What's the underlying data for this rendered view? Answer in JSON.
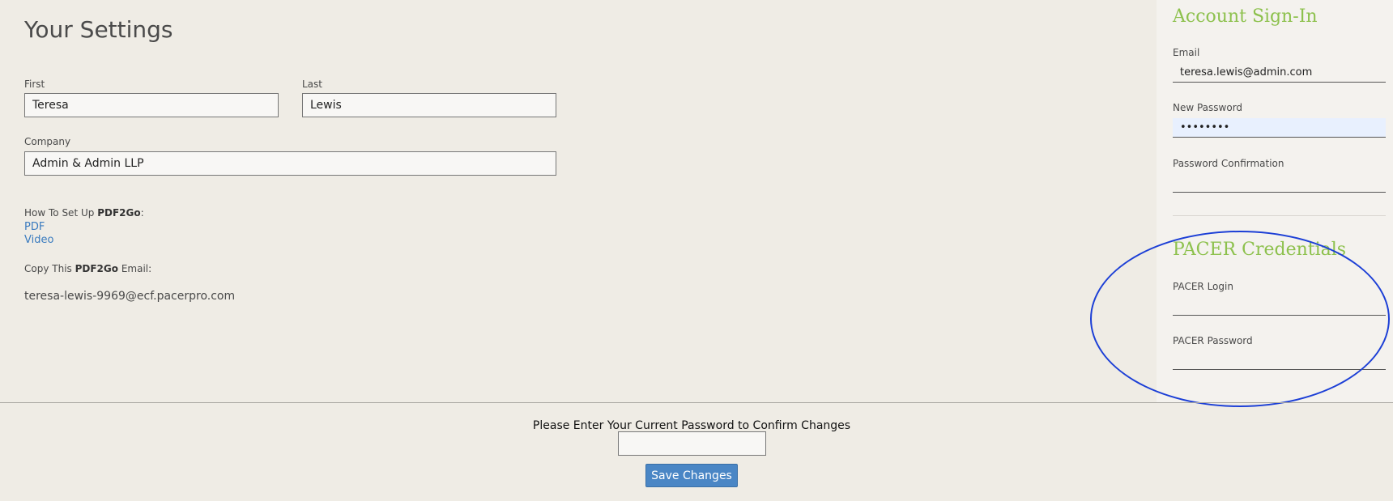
{
  "page": {
    "title": "Your Settings"
  },
  "profile": {
    "first_label": "First",
    "first_value": "Teresa",
    "last_label": "Last",
    "last_value": "Lewis",
    "company_label": "Company",
    "company_value": "Admin & Admin LLP"
  },
  "setup": {
    "how_to_prefix": "How To Set Up ",
    "brand": "PDF2Go",
    "how_to_suffix": ":",
    "links": [
      "PDF",
      "Video"
    ],
    "copy_prefix": "Copy This ",
    "copy_suffix": " Email:",
    "ecf_email": "teresa-lewis-9969@ecf.pacerpro.com"
  },
  "account": {
    "heading": "Account Sign-In",
    "email_label": "Email",
    "email_value": "teresa.lewis@admin.com",
    "new_password_label": "New Password",
    "new_password_value": "••••••••",
    "confirm_label": "Password Confirmation",
    "confirm_value": ""
  },
  "pacer": {
    "heading": "PACER Credentials",
    "login_label": "PACER Login",
    "login_value": "",
    "password_label": "PACER Password",
    "password_value": ""
  },
  "footer": {
    "confirm_prompt": "Please Enter Your Current Password to Confirm Changes",
    "current_password_value": "",
    "save_label": "Save Changes"
  },
  "colors": {
    "background": "#efece5",
    "sidebar": "#f4f2ee",
    "accent_green": "#8dc14d",
    "link_blue": "#3a7bbf",
    "button_blue": "#4a86c5",
    "annotation_oval": "#1c3fd6",
    "autofill": "#e8f0fe"
  }
}
